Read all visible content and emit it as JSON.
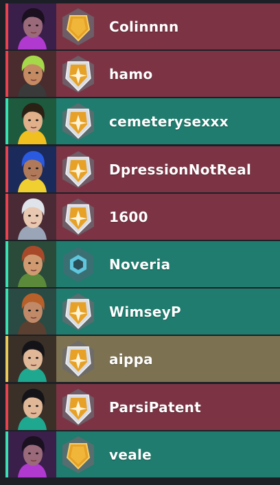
{
  "colors": {
    "red_team_bg": "#7c3444",
    "red_team_stripe": "#e8424f",
    "teal_team_bg": "#1f7c6e",
    "teal_team_stripe": "#3be0b2",
    "self_bg": "#7c7151",
    "self_stripe": "#e8c95a"
  },
  "players": [
    {
      "name": "Colinnnn",
      "team": "red",
      "rank_icon": "gold-rank-icon",
      "agent_icon": "reyna-portrait-icon"
    },
    {
      "name": "hamo",
      "team": "red",
      "rank_icon": "silver-rank-icon",
      "agent_icon": "neon-green-hair-portrait-icon"
    },
    {
      "name": "cemeterysexxx",
      "team": "teal",
      "rank_icon": "silver-rank-icon",
      "agent_icon": "killjoy-portrait-icon"
    },
    {
      "name": "DpressionNotReal",
      "team": "red",
      "rank_icon": "silver-rank-icon",
      "agent_icon": "neon-portrait-icon"
    },
    {
      "name": "1600",
      "team": "red",
      "rank_icon": "silver-rank-icon",
      "agent_icon": "jett-portrait-icon"
    },
    {
      "name": "Noveria",
      "team": "teal",
      "rank_icon": "unranked-rank-icon",
      "agent_icon": "skye-portrait-icon"
    },
    {
      "name": "WimseyP",
      "team": "teal",
      "rank_icon": "silver-rank-icon",
      "agent_icon": "brimstone-portrait-icon"
    },
    {
      "name": "aippa",
      "team": "self",
      "rank_icon": "silver-rank-icon",
      "agent_icon": "sage-portrait-icon"
    },
    {
      "name": "ParsiPatent",
      "team": "red",
      "rank_icon": "silver-rank-icon",
      "agent_icon": "sage-portrait-icon"
    },
    {
      "name": "veale",
      "team": "teal",
      "rank_icon": "gold-rank-icon",
      "agent_icon": "reyna-portrait-icon"
    }
  ]
}
